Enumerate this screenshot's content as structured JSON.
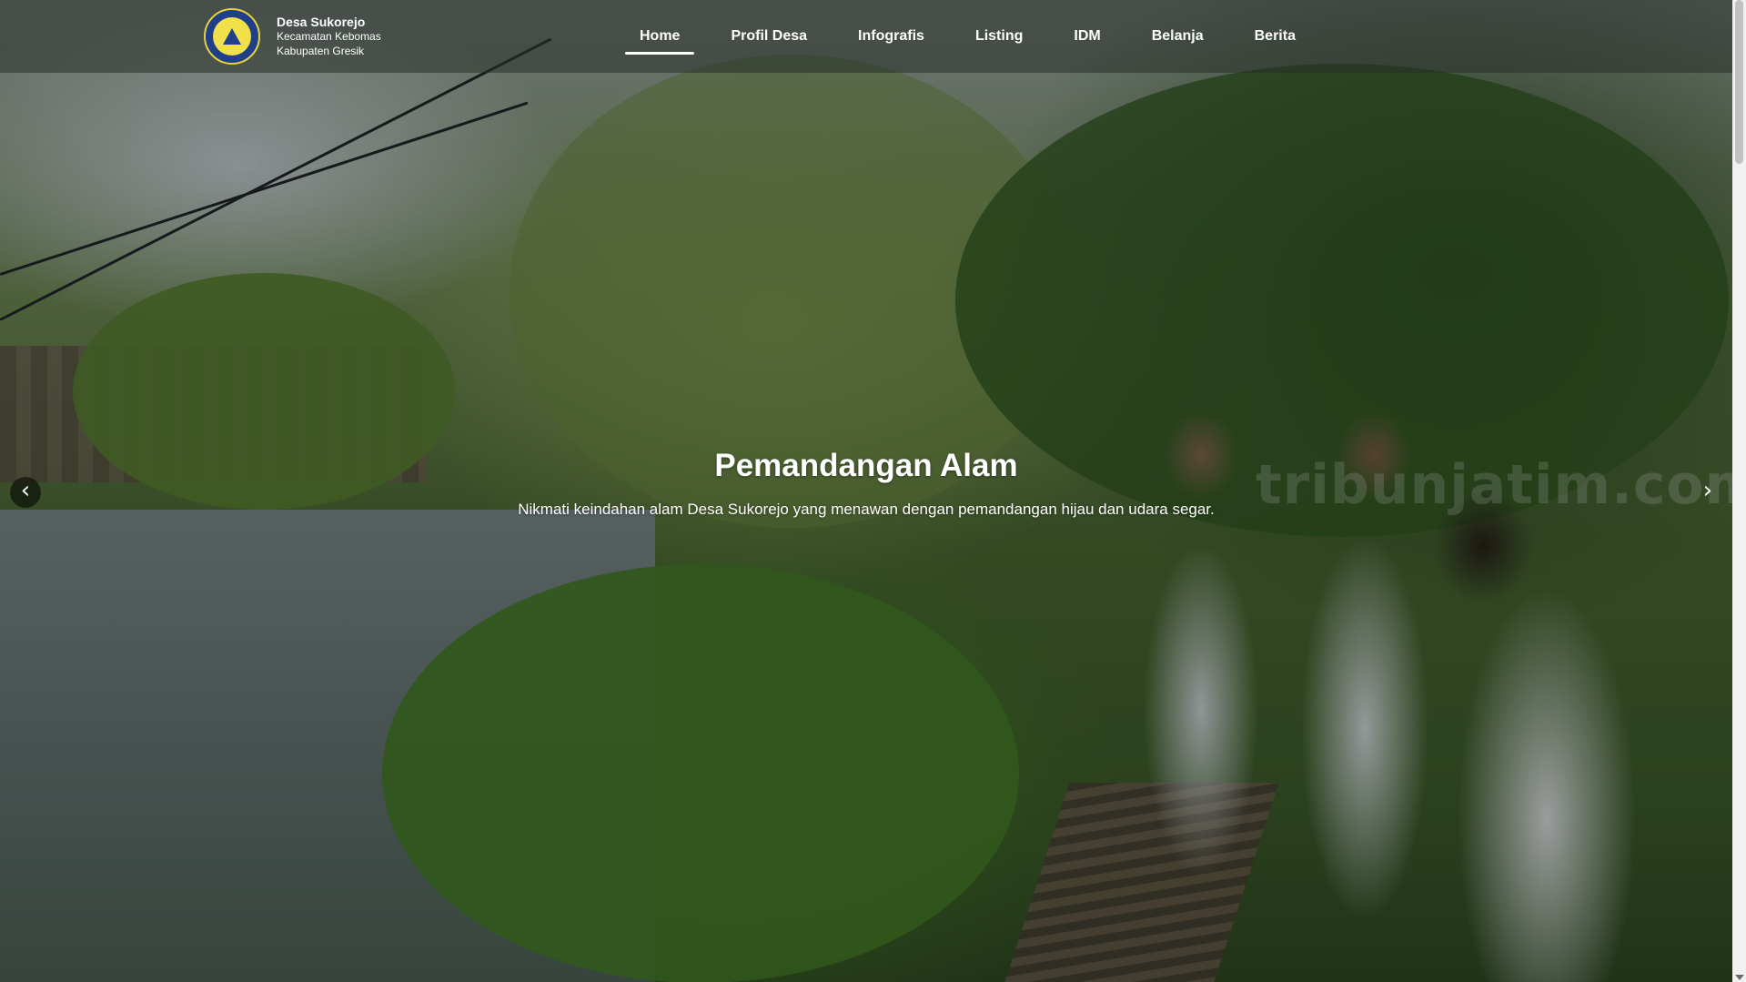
{
  "brand": {
    "title": "Desa Sukorejo",
    "subtitle_1": "Kecamatan Kebomas",
    "subtitle_2": "Kabupaten Gresik",
    "logo_icon": "village-emblem"
  },
  "nav": {
    "items": [
      {
        "label": "Home",
        "active": true
      },
      {
        "label": "Profil Desa",
        "active": false
      },
      {
        "label": "Infografis",
        "active": false
      },
      {
        "label": "Listing",
        "active": false
      },
      {
        "label": "IDM",
        "active": false
      },
      {
        "label": "Belanja",
        "active": false
      },
      {
        "label": "Berita",
        "active": false
      }
    ]
  },
  "hero": {
    "title": "Pemandangan Alam",
    "description": "Nikmati keindahan alam Desa Sukorejo yang menawan dengan pemandangan hijau dan udara segar.",
    "watermark": "tribunjatim.com",
    "prev_icon": "‹",
    "next_icon": "›"
  },
  "colors": {
    "header_bg": "#28302880",
    "text": "#ffffff",
    "logo_blue": "#1f3f8a",
    "logo_yellow": "#f2e04a"
  }
}
